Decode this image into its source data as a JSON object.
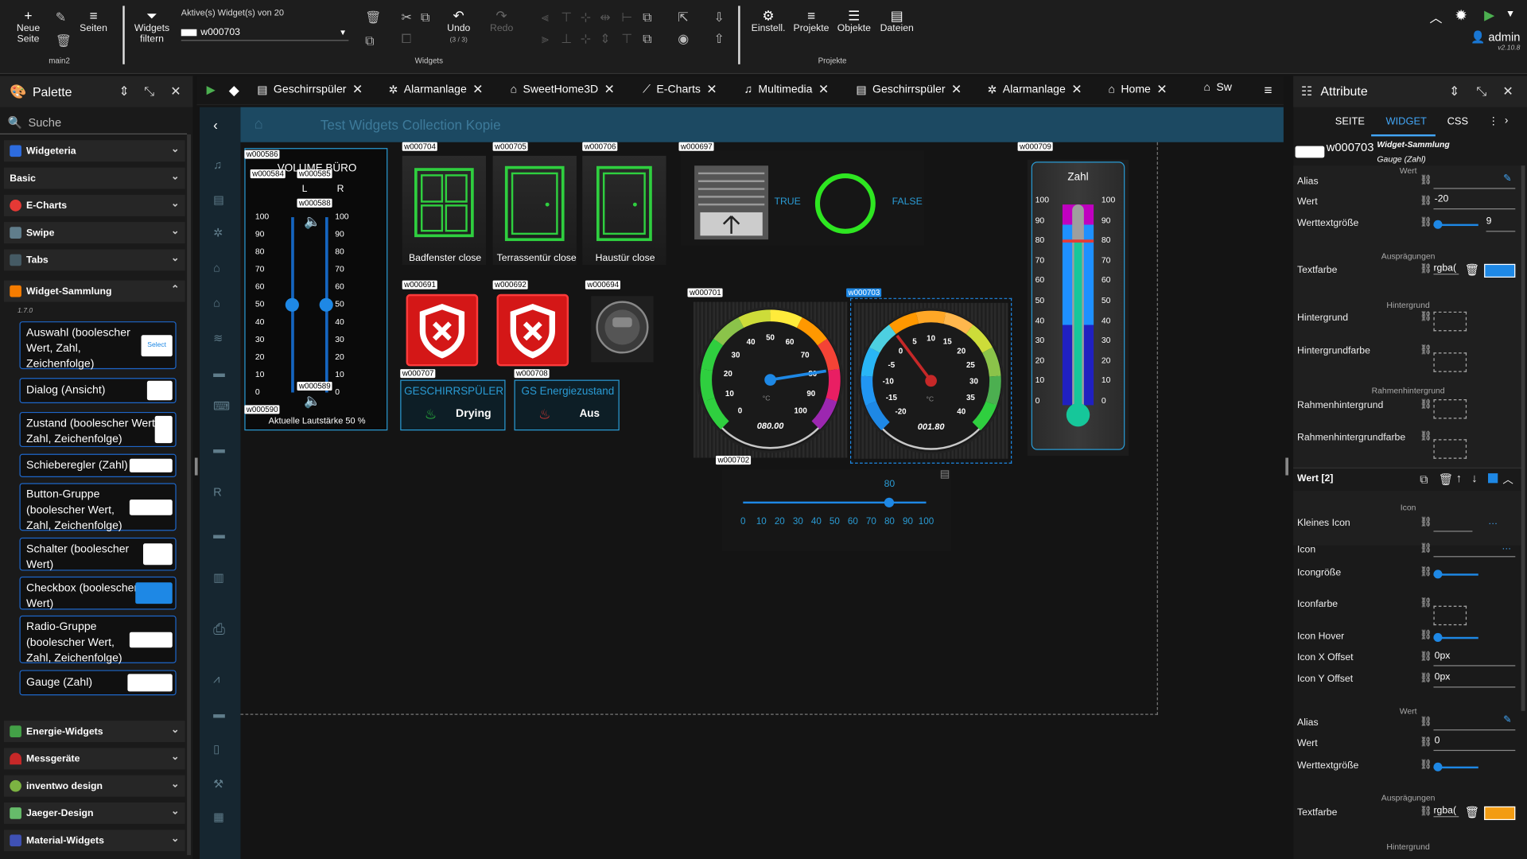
{
  "toolbar": {
    "new_page": "Neue Seite",
    "pages": "Seiten",
    "page_name": "main2",
    "filter": "Widgets filtern",
    "active_label": "Aktive(s) Widget(s) von 20",
    "active_value": "w000703",
    "undo": "Undo",
    "undo_count": "(3 / 3)",
    "redo": "Redo",
    "widgets_group": "Widgets",
    "settings": "Einstell.",
    "projects": "Projekte",
    "objects": "Objekte",
    "files": "Dateien",
    "projects_group": "Projekte",
    "user": "admin",
    "version": "v2.10.8"
  },
  "palette": {
    "title": "Palette",
    "search": "Suche",
    "categories": [
      "Widgeteria",
      "Basic",
      "E-Charts",
      "Swipe",
      "Tabs",
      "Widget-Sammlung"
    ],
    "version": "1.7.0",
    "items": [
      "Auswahl (boolescher Wert, Zahl, Zeichenfolge)",
      "Dialog (Ansicht)",
      "Zustand (boolescher Wert, Zahl, Zeichenfolge)",
      "Schieberegler (Zahl)",
      "Button-Gruppe (boolescher Wert, Zahl, Zeichenfolge)",
      "Schalter (boolescher Wert)",
      "Checkbox (boolescher Wert)",
      "Radio-Gruppe (boolescher Wert, Zahl, Zeichenfolge)",
      "Gauge (Zahl)"
    ],
    "select_preview": "Select",
    "bottom_categories": [
      "Energie-Widgets",
      "Messgeräte",
      "inventwo design",
      "Jaeger-Design",
      "Material-Widgets"
    ]
  },
  "tabs": [
    "Geschirrspüler",
    "Alarmanlage",
    "SweetHome3D",
    "E-Charts",
    "Multimedia",
    "Geschirrspüler",
    "Alarmanlage",
    "Home",
    "Sw"
  ],
  "view": {
    "title": "Test Widgets Collection Kopie",
    "widget_ids": [
      "w000586",
      "w000584",
      "w000585",
      "w000588",
      "w000589",
      "w000590",
      "w000704",
      "w000705",
      "w000706",
      "w000697",
      "w000709",
      "w000691",
      "w000692",
      "w000694",
      "w000707",
      "w000708",
      "w000701",
      "w000703",
      "w000702"
    ],
    "volume": {
      "title": "VOLUME BÜRO",
      "left": "L",
      "right": "R",
      "ticks": [
        "100",
        "90",
        "80",
        "70",
        "60",
        "50",
        "40",
        "30",
        "20",
        "10",
        "0"
      ],
      "footer": "Aktuelle Lautstärke 50 %",
      "value": 50
    },
    "doors": [
      "Badfenster close",
      "Terrassentür close",
      "Haustür close"
    ],
    "true_label": "TRUE",
    "false_label": "FALSE",
    "cards": [
      {
        "title": "GESCHIRRSPÜLER",
        "value": "Drying"
      },
      {
        "title": "GS Energiezustand",
        "value": "Aus"
      }
    ],
    "gauge1": {
      "ticks": [
        "0",
        "10",
        "20",
        "30",
        "40",
        "50",
        "60",
        "70",
        "80",
        "90",
        "100"
      ],
      "unit": "°C",
      "readout": "080.00",
      "value": 80
    },
    "gauge2": {
      "ticks": [
        "-20",
        "-15",
        "-10",
        "-5",
        "0",
        "5",
        "10",
        "15",
        "20",
        "25",
        "30",
        "35",
        "40"
      ],
      "unit": "°C",
      "readout": "001.80",
      "value": 1.8
    },
    "thermo": {
      "title": "Zahl",
      "ticks": [
        "100",
        "90",
        "80",
        "70",
        "60",
        "50",
        "40",
        "30",
        "20",
        "10",
        "0"
      ],
      "value": 80
    },
    "slider": {
      "value_label": "80",
      "ticks": [
        "0",
        "10",
        "20",
        "30",
        "40",
        "50",
        "60",
        "70",
        "80",
        "90",
        "100"
      ],
      "value": 80
    }
  },
  "attr": {
    "title": "Attribute",
    "tabs": [
      "SEITE",
      "WIDGET",
      "CSS"
    ],
    "widget_id": "w000703",
    "widget_set": "Widget-Sammlung",
    "widget_type": "Gauge (Zahl)",
    "sec_wert": "Wert",
    "alias": "Alias",
    "wert": "Wert",
    "wert_val": "-20",
    "werttextgroesse": "Werttextgröße",
    "werttext_val": "9",
    "sec_auspraeg": "Ausprägungen",
    "textfarbe": "Textfarbe",
    "textfarbe_val": "rgba(",
    "sec_hintergrund": "Hintergrund",
    "hintergrund": "Hintergrund",
    "hintergrundfarbe": "Hintergrundfarbe",
    "sec_rahmen": "Rahmenhintergrund",
    "rahmenhintergrund": "Rahmenhintergrund",
    "rahmenhintergrundfarbe": "Rahmenhintergrundfarbe",
    "wert2": "Wert [2]",
    "sec_icon": "Icon",
    "kleines_icon": "Kleines Icon",
    "icon": "Icon",
    "icongroesse": "Icongröße",
    "iconfarbe": "Iconfarbe",
    "icon_hover": "Icon Hover",
    "icon_x": "Icon X Offset",
    "icon_x_val": "0px",
    "icon_y": "Icon Y Offset",
    "icon_y_val": "0px",
    "wert_b": "Wert",
    "wert_b_val": "0",
    "textfarbe_b_val": "rgba(",
    "accent_blue": "#1e88e5",
    "accent_orange": "#f39c12"
  }
}
